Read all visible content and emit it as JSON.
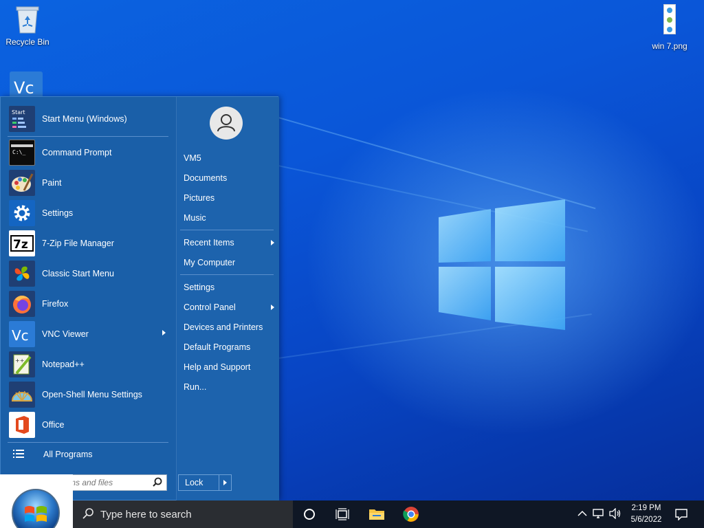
{
  "desktop": {
    "icons": [
      {
        "label": "Recycle Bin",
        "icon": "recycle-bin-icon"
      },
      {
        "label": "win 7.png",
        "icon": "image-file-icon"
      }
    ]
  },
  "start_menu": {
    "programs": [
      {
        "label": "Start Menu (Windows)",
        "icon": "start-menu-windows-icon",
        "submenu": false
      },
      {
        "label": "Command Prompt",
        "icon": "command-prompt-icon",
        "submenu": false
      },
      {
        "label": "Paint",
        "icon": "paint-icon",
        "submenu": false
      },
      {
        "label": "Settings",
        "icon": "settings-gear-icon",
        "submenu": false
      },
      {
        "label": "7-Zip File Manager",
        "icon": "7zip-icon",
        "submenu": false
      },
      {
        "label": "Classic Start Menu",
        "icon": "classic-start-menu-icon",
        "submenu": false
      },
      {
        "label": "Firefox",
        "icon": "firefox-icon",
        "submenu": false
      },
      {
        "label": "VNC Viewer",
        "icon": "vnc-viewer-icon",
        "submenu": true
      },
      {
        "label": "Notepad++",
        "icon": "notepad-plus-plus-icon",
        "submenu": false
      },
      {
        "label": "Open-Shell Menu Settings",
        "icon": "open-shell-icon",
        "submenu": false
      },
      {
        "label": "Office",
        "icon": "office-icon",
        "submenu": false
      }
    ],
    "all_programs": "All Programs",
    "search_placeholder": "Search programs and files",
    "search_visible_text": "s and files",
    "right_items": [
      {
        "label": "VM5",
        "submenu": false
      },
      {
        "label": "Documents",
        "submenu": false
      },
      {
        "label": "Pictures",
        "submenu": false
      },
      {
        "label": "Music",
        "submenu": false
      },
      {
        "label": "Recent Items",
        "submenu": true
      },
      {
        "label": "My Computer",
        "submenu": false
      },
      {
        "label": "Settings",
        "submenu": false
      },
      {
        "label": "Control Panel",
        "submenu": true
      },
      {
        "label": "Devices and Printers",
        "submenu": false
      },
      {
        "label": "Default Programs",
        "submenu": false
      },
      {
        "label": "Help and Support",
        "submenu": false
      },
      {
        "label": "Run...",
        "submenu": false
      }
    ],
    "lock_label": "Lock"
  },
  "taskbar": {
    "search_placeholder": "Type here to search",
    "pinned": [
      "cortana-icon",
      "task-view-icon",
      "file-explorer-icon",
      "chrome-icon"
    ],
    "tray_icons": [
      "chevron-up-icon",
      "network-icon",
      "volume-icon"
    ],
    "time": "2:19 PM",
    "date": "5/6/2022",
    "notification_icon": "action-center-icon"
  },
  "colors": {
    "menu_bg": "#1a5fa8",
    "taskbar_bg": "#0f1725",
    "wallpaper": "#0a56d8"
  }
}
